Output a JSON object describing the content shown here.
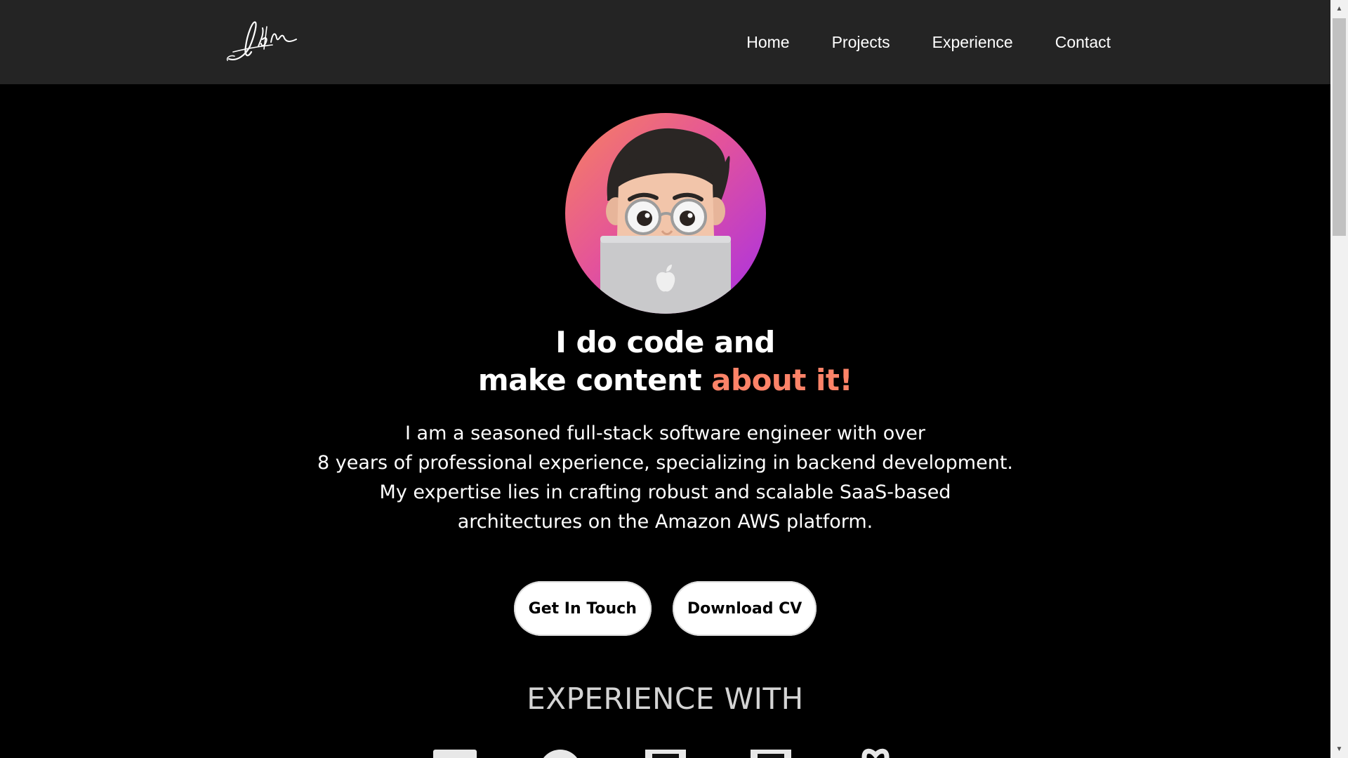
{
  "header": {
    "logo_text": "Ab/n",
    "nav": [
      {
        "label": "Home"
      },
      {
        "label": "Projects"
      },
      {
        "label": "Experience"
      },
      {
        "label": "Contact"
      }
    ]
  },
  "hero": {
    "headline_line1": "I do code and",
    "headline_line2_plain": "make content ",
    "headline_line2_accent": "about it!",
    "intro_lines": [
      "I am a seasoned full-stack software engineer with over",
      "8 years of professional experience, specializing in backend development.",
      "My expertise lies in crafting robust and scalable SaaS-based",
      "architectures on the Amazon AWS platform."
    ],
    "buttons": {
      "contact_label": "Get In Touch",
      "cv_label": "Download CV"
    }
  },
  "experience": {
    "title": "EXPERIENCE WITH",
    "icons": [
      "square-icon",
      "circle-icon",
      "box-icon",
      "box-icon",
      "bracket-icon"
    ]
  },
  "colors": {
    "accent": "#fd8368",
    "header_bg": "#242424",
    "page_bg": "#000000",
    "avatar_gradient": [
      "#f7835e",
      "#e4539a",
      "#a730e6"
    ]
  }
}
